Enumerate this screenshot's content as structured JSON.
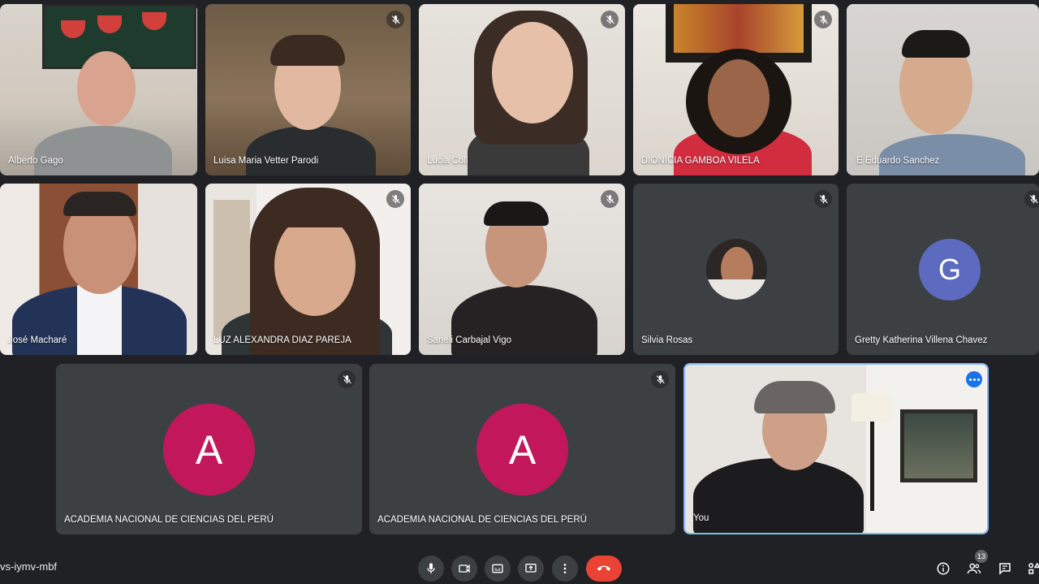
{
  "participants": [
    {
      "name": "Alberto Gago",
      "muted": false
    },
    {
      "name": "Luisa Maria Vetter Parodi",
      "muted": true
    },
    {
      "name": "Lucia Coll",
      "muted": true
    },
    {
      "name": "DIONICIA GAMBOA VILELA",
      "muted": true
    },
    {
      "name": "E Eduardo Sanchez",
      "muted": false
    },
    {
      "name": "José Macharé",
      "muted": false
    },
    {
      "name": "LUZ ALEXANDRA DIAZ PAREJA",
      "muted": true
    },
    {
      "name": "Saneli Carbajal Vigo",
      "muted": true
    },
    {
      "name": "Silvia Rosas",
      "muted": true
    },
    {
      "name": "Gretty Katherina Villena Chavez",
      "muted": true,
      "initial": "G",
      "avatar_color": "#5c6bc0"
    },
    {
      "name": "ACADEMIA NACIONAL DE CIENCIAS DEL PERÚ",
      "muted": true,
      "initial": "A",
      "avatar_color": "#c2185b"
    },
    {
      "name": "ACADEMIA NACIONAL DE CIENCIAS DEL PERÚ",
      "muted": true,
      "initial": "A",
      "avatar_color": "#c2185b"
    },
    {
      "name": "You",
      "muted": false,
      "active_speaker": true
    }
  ],
  "meeting": {
    "code": "vs-iymv-mbf",
    "participant_count": "13"
  },
  "controls": [
    {
      "icon": "microphone-icon"
    },
    {
      "icon": "camera-icon"
    },
    {
      "icon": "captions-icon"
    },
    {
      "icon": "present-screen-icon"
    },
    {
      "icon": "more-options-icon"
    },
    {
      "icon": "end-call-icon"
    }
  ],
  "side_controls": [
    {
      "icon": "info-icon"
    },
    {
      "icon": "people-icon"
    },
    {
      "icon": "chat-icon"
    },
    {
      "icon": "activities-icon"
    }
  ],
  "colors": {
    "background": "#202124",
    "tile": "#3c4043",
    "accent": "#8ab4f8",
    "end_call": "#ea4335"
  }
}
